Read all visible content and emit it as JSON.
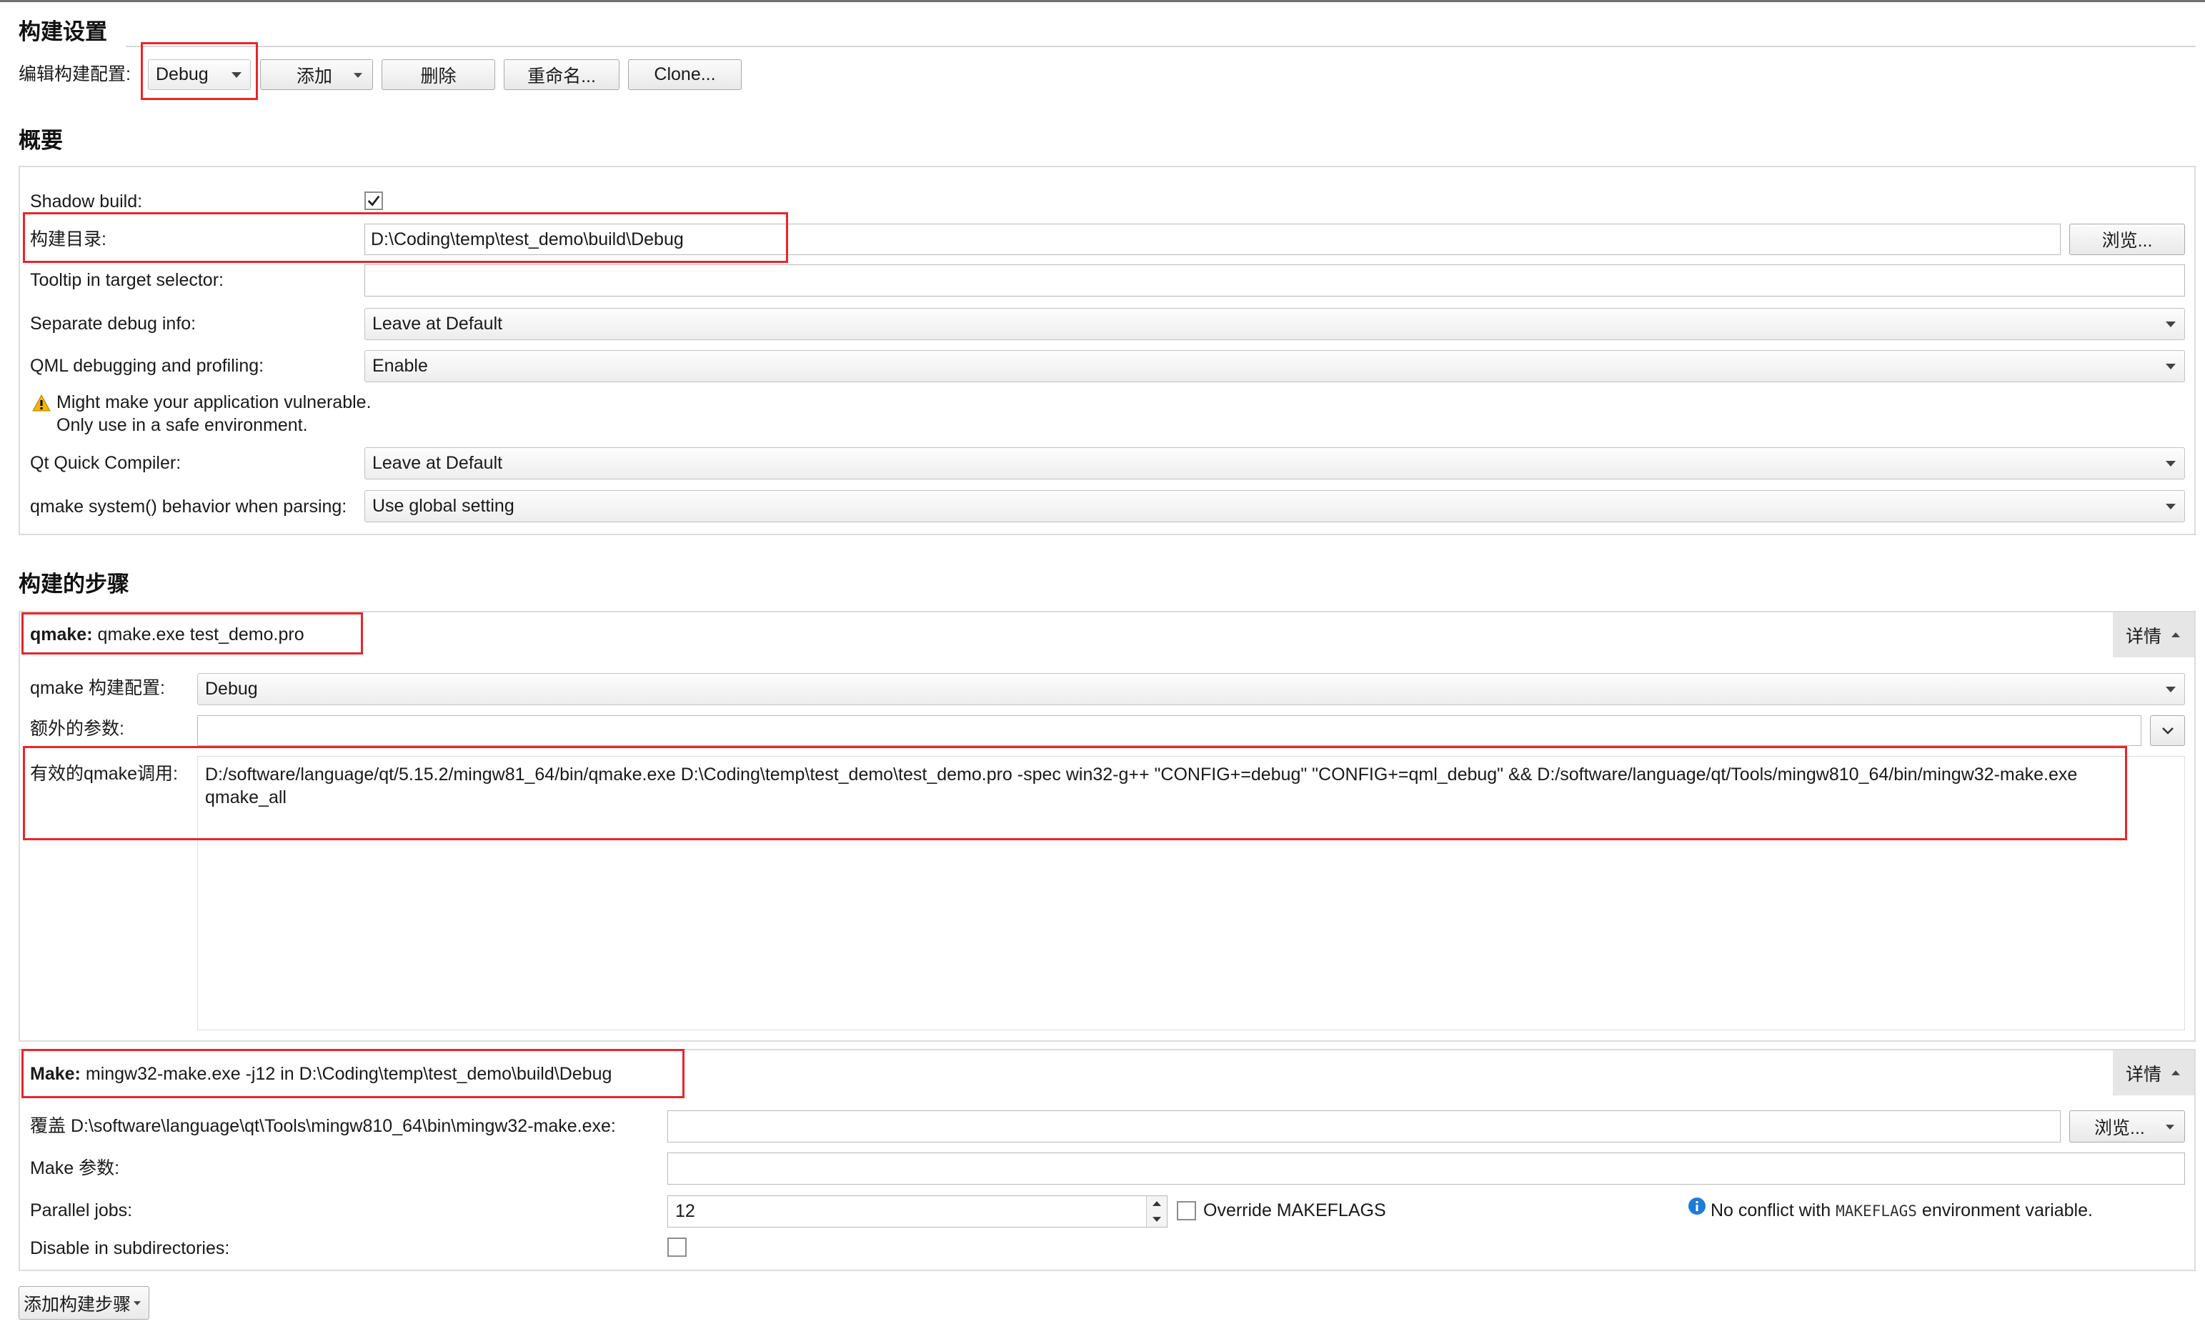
{
  "build_settings": {
    "title": "构建设置",
    "edit_config_label": "编辑构建配置:",
    "config_selected": "Debug",
    "add_label": "添加",
    "delete_label": "删除",
    "rename_label": "重命名...",
    "clone_label": "Clone..."
  },
  "general": {
    "title": "概要",
    "shadow_build": {
      "label": "Shadow build:",
      "checked": true
    },
    "build_dir": {
      "label": "构建目录:",
      "value": "D:\\Coding\\temp\\test_demo\\build\\Debug",
      "browse_label": "浏览..."
    },
    "tooltip": {
      "label": "Tooltip in target selector:",
      "value": ""
    },
    "separate_debug": {
      "label": "Separate debug info:",
      "value": "Leave at Default"
    },
    "qml_debug": {
      "label": "QML debugging and profiling:",
      "value": "Enable"
    },
    "warning": {
      "line1": "Might make your application vulnerable.",
      "line2": "Only use in a safe environment."
    },
    "qt_quick_compiler": {
      "label": "Qt Quick Compiler:",
      "value": "Leave at Default"
    },
    "qmake_system": {
      "label": "qmake system() behavior when parsing:",
      "value": "Use global setting"
    }
  },
  "build_steps": {
    "title": "构建的步骤",
    "qmake_step": {
      "header_name": "qmake:",
      "header_command": "qmake.exe test_demo.pro",
      "details_label": "详情",
      "build_config": {
        "label": "qmake 构建配置:",
        "value": "Debug"
      },
      "extra_args": {
        "label": "额外的参数:",
        "value": ""
      },
      "effective_call": {
        "label": "有效的qmake调用:",
        "value": "D:/software/language/qt/5.15.2/mingw81_64/bin/qmake.exe D:\\Coding\\temp\\test_demo\\test_demo.pro -spec win32-g++ \"CONFIG+=debug\" \"CONFIG+=qml_debug\" && D:/software/language/qt/Tools/mingw810_64/bin/mingw32-make.exe qmake_all"
      }
    },
    "make_step": {
      "header_name": "Make:",
      "header_command": "mingw32-make.exe -j12 in D:\\Coding\\temp\\test_demo\\build\\Debug",
      "details_label": "详情",
      "override": {
        "label": "覆盖 D:\\software\\language\\qt\\Tools\\mingw810_64\\bin\\mingw32-make.exe:",
        "value": "",
        "browse_label": "浏览..."
      },
      "make_args": {
        "label": "Make 参数:",
        "value": ""
      },
      "parallel_jobs": {
        "label": "Parallel jobs:",
        "value": "12"
      },
      "override_makeflags": {
        "label": "Override MAKEFLAGS",
        "checked": false
      },
      "info": {
        "prefix": "No conflict with",
        "code": "MAKEFLAGS",
        "suffix": "environment variable."
      },
      "disable_subdirs": {
        "label": "Disable in subdirectories:",
        "checked": false
      }
    },
    "add_step_label": "添加构建步骤"
  },
  "colors": {
    "highlight": "#e8262b",
    "info": "#1f7bd8",
    "warning": "#f3b400"
  }
}
